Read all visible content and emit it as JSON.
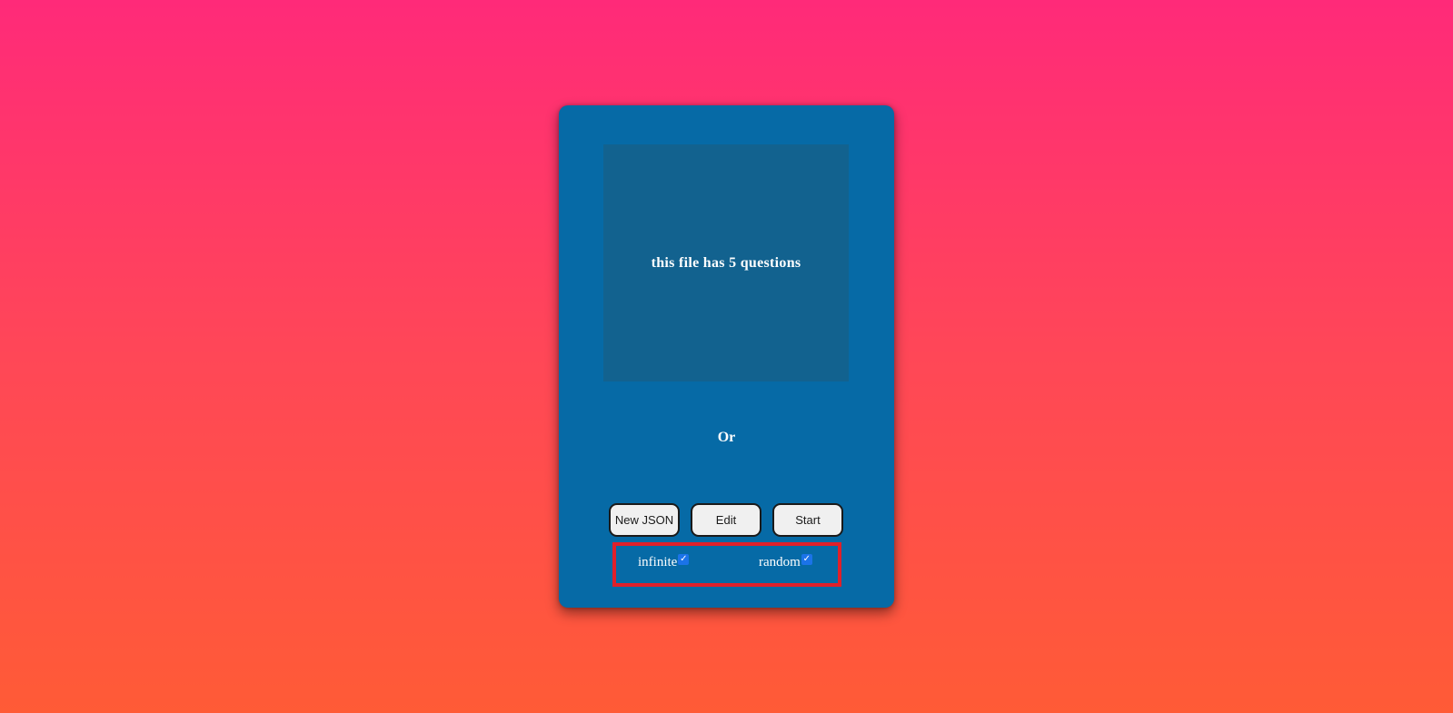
{
  "dropzone": {
    "text": "this file has 5 questions"
  },
  "divider": {
    "label": "Or"
  },
  "buttons": {
    "new_json_label": "New JSON",
    "edit_label": "Edit",
    "start_label": "Start"
  },
  "options": {
    "infinite_label": "infinite",
    "infinite_checked": true,
    "random_label": "random",
    "random_checked": true
  },
  "colors": {
    "card_background": "#066aa6",
    "dropzone_background": "#12628f",
    "highlight_border": "#e0202a",
    "gradient_top": "#ff2a79",
    "gradient_bottom": "#ff5b36"
  }
}
